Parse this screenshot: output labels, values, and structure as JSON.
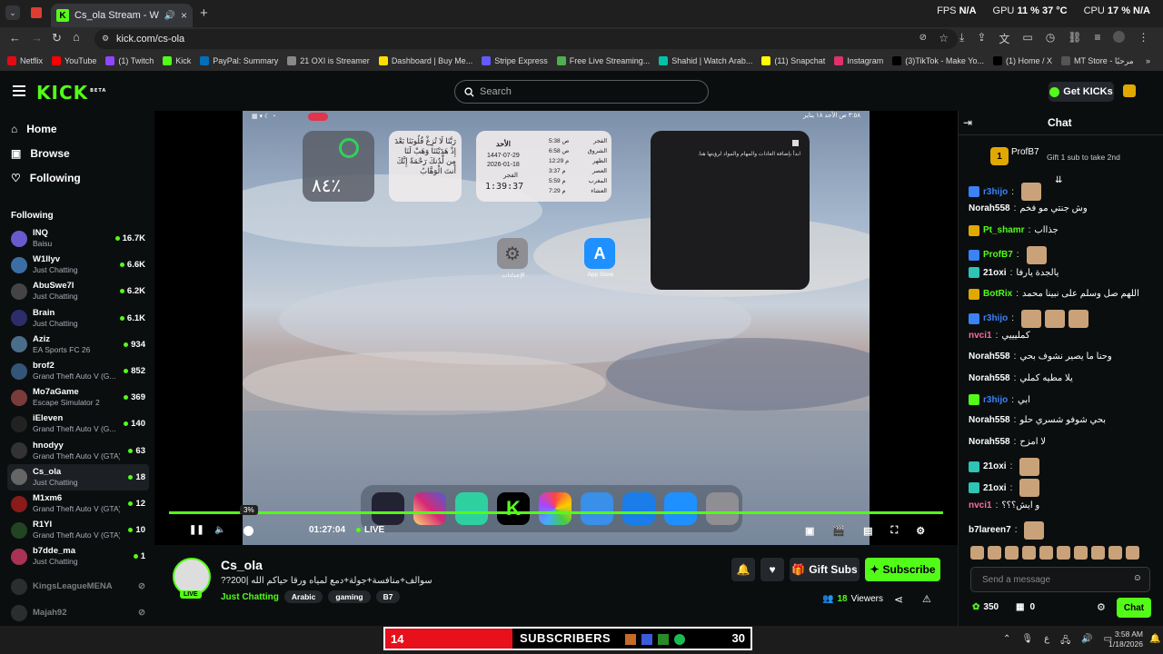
{
  "browser": {
    "tab_title": "Cs_ola Stream - Watch Live",
    "url": "kick.com/cs-ola",
    "stats": {
      "fps_label": "FPS",
      "fps": "N/A",
      "gpu_label": "GPU",
      "gpu": "11 %",
      "gpu_temp": "37 °C",
      "cpu_label": "CPU",
      "cpu": "17 %",
      "cpu_temp": "N/A"
    },
    "bookmarks": [
      {
        "label": "Netflix",
        "color": "#e50914"
      },
      {
        "label": "YouTube",
        "color": "#ff0000"
      },
      {
        "label": "(1) Twitch",
        "color": "#9146ff"
      },
      {
        "label": "Kick",
        "color": "#53fc18"
      },
      {
        "label": "PayPal: Summary",
        "color": "#0070ba"
      },
      {
        "label": "21 OXI is Streamer",
        "color": "#888888"
      },
      {
        "label": "Dashboard | Buy Me...",
        "color": "#ffdd00"
      },
      {
        "label": "Stripe Express",
        "color": "#635bff"
      },
      {
        "label": "Free Live Streaming...",
        "color": "#4caf50"
      },
      {
        "label": "Shahid | Watch Arab...",
        "color": "#00c2a8"
      },
      {
        "label": "(11) Snapchat",
        "color": "#fffc00"
      },
      {
        "label": "Instagram",
        "color": "#e1306c"
      },
      {
        "label": "(3)TikTok - Make Yo...",
        "color": "#000000"
      },
      {
        "label": "(1) Home / X",
        "color": "#000000"
      },
      {
        "label": "MT Store - مرحبًا",
        "color": "#555555"
      }
    ]
  },
  "header": {
    "logo": "KICK",
    "beta": "BETA",
    "search_placeholder": "Search",
    "get_kicks": "Get KICKs"
  },
  "sidebar": {
    "nav": [
      {
        "label": "Home"
      },
      {
        "label": "Browse"
      },
      {
        "label": "Following"
      }
    ],
    "following_heading": "Following",
    "channels": [
      {
        "name": "INQ",
        "game": "Baisu",
        "viewers": "16.7K",
        "color": "#6a5acd"
      },
      {
        "name": "W1llyv",
        "game": "Just Chatting",
        "viewers": "6.6K",
        "color": "#3b6ea5"
      },
      {
        "name": "AbuSwe7l",
        "game": "Just Chatting",
        "viewers": "6.2K",
        "color": "#444444"
      },
      {
        "name": "Brain",
        "game": "Just Chatting",
        "viewers": "6.1K",
        "color": "#2d2d6b"
      },
      {
        "name": "Aziz",
        "game": "EA Sports FC 26",
        "viewers": "934",
        "color": "#4a6d8c"
      },
      {
        "name": "brof2",
        "game": "Grand Theft Auto V (G...",
        "viewers": "852",
        "color": "#335577"
      },
      {
        "name": "Mo7aGame",
        "game": "Escape Simulator 2",
        "viewers": "369",
        "color": "#7a3b3b"
      },
      {
        "name": "iEleven",
        "game": "Grand Theft Auto V (G...",
        "viewers": "140",
        "color": "#222222"
      },
      {
        "name": "hnodyy",
        "game": "Grand Theft Auto V (GTA)",
        "viewers": "63",
        "color": "#333333"
      },
      {
        "name": "Cs_ola",
        "game": "Just Chatting",
        "viewers": "18",
        "color": "#666666"
      },
      {
        "name": "M1xm6",
        "game": "Grand Theft Auto V (GTA)",
        "viewers": "12",
        "color": "#8b1a1a"
      },
      {
        "name": "R1YI",
        "game": "Grand Theft Auto V (GTA)",
        "viewers": "10",
        "color": "#224422"
      },
      {
        "name": "b7dde_ma",
        "game": "Just Chatting",
        "viewers": "1",
        "color": "#aa3355"
      }
    ],
    "offline": [
      {
        "name": "KingsLeagueMENA"
      },
      {
        "name": "Majah92"
      }
    ]
  },
  "video": {
    "widgets": {
      "battery": "٨٤٪",
      "prayer_day": "الأحد",
      "hijri": "1447-07-29",
      "gregorian": "2026-01-18",
      "next_prayer": "الفجر",
      "countdown": "1:39:37",
      "prayers": [
        {
          "name": "الفجر",
          "time": "5:38 ص"
        },
        {
          "name": "الشروق",
          "time": "6:58 ص"
        },
        {
          "name": "الظهر",
          "time": "12:29 م"
        },
        {
          "name": "العصر",
          "time": "3:37 م"
        },
        {
          "name": "المغرب",
          "time": "5:59 م"
        },
        {
          "name": "العشاء",
          "time": "7:29 م"
        }
      ],
      "dua": "رَبَّنَا لَا تُزِغْ قُلُوبَنَا بَعْدَ إِذْ هَدَيْتَنَا وَهَبْ لَنَا مِن لَّدُنكَ رَحْمَةً إِنَّكَ أَنتَ الْوَهَّابُ",
      "notes": "ابدأ بإضافة العادات والمهام والمواد لرؤيتها هنا.",
      "settings_label": "الإعدادات",
      "appstore_label": "App Store",
      "ipad_status_right": "٣:٥٨ ص  الأحد ١٨ يناير"
    },
    "volume_tooltip": "3%",
    "elapsed": "01:27:04",
    "live": "LIVE",
    "progress": 1.0
  },
  "stream": {
    "channel": "Cs_ola",
    "live_badge": "LIVE",
    "title": "??سوالف+منافسة+جولة+دمع لمياه ورقا حياكم الله |200",
    "category": "Just Chatting",
    "tags": [
      "Arabic",
      "gaming",
      "B7"
    ],
    "viewers": "18",
    "viewers_label": "Viewers",
    "gift_subs": "Gift Subs",
    "subscribe": "Subscribe"
  },
  "chat": {
    "title": "Chat",
    "pinned_user": "ProfB7",
    "pinned_count": "1",
    "pinned_text": "Gift 1 sub to take 2nd",
    "messages": [
      {
        "user": "r3hijo",
        "color": "#3b82f6",
        "text": "",
        "emotes": 1
      },
      {
        "user": "Norah558",
        "color": "#ffffff",
        "text": "وش جنتي مو فخم",
        "emotes": 0
      },
      {
        "user": "Pt_shamr",
        "color": "#53fc18",
        "text": "جذااب",
        "emotes": 0
      },
      {
        "user": "ProfB7",
        "color": "#53fc18",
        "text": "",
        "emotes": 1
      },
      {
        "user": "21oxi",
        "color": "#ffffff",
        "text": "يالجدة يارفا",
        "emotes": 0
      },
      {
        "user": "BotRix",
        "color": "#53fc18",
        "text": "اللهم صل وسلم على نبينا محمد",
        "emotes": 0
      },
      {
        "user": "r3hijo",
        "color": "#3b82f6",
        "text": "",
        "emotes": 3
      },
      {
        "user": "nvci1",
        "color": "#ff6b9a",
        "text": "كمليييي",
        "emotes": 0
      },
      {
        "user": "Norah558",
        "color": "#ffffff",
        "text": "وحنا ما يصير نشوف بحي",
        "emotes": 0
      },
      {
        "user": "Norah558",
        "color": "#ffffff",
        "text": "يلا مطيه كملي",
        "emotes": 0
      },
      {
        "user": "r3hijo",
        "color": "#3b82f6",
        "text": "ابي",
        "emotes": 0
      },
      {
        "user": "Norah558",
        "color": "#ffffff",
        "text": "بحي شوفو شسري حلو",
        "emotes": 0
      },
      {
        "user": "Norah558",
        "color": "#ffffff",
        "text": "لا امزح",
        "emotes": 0
      },
      {
        "user": "21oxi",
        "color": "#ffffff",
        "text": "",
        "emotes": 1
      },
      {
        "user": "21oxi",
        "color": "#ffffff",
        "text": "",
        "emotes": 1
      },
      {
        "user": "nvci1",
        "color": "#ff6b9a",
        "text": "و ايش؟؟؟",
        "emotes": 0
      },
      {
        "user": "b7lareen7",
        "color": "#ffffff",
        "text": "",
        "emotes": 1
      }
    ],
    "send_placeholder": "Send a message",
    "points": "350",
    "gifts": "0",
    "chat_button": "Chat"
  },
  "taskbar": {
    "sub_count": "14",
    "sub_label": "SUBSCRIBERS",
    "sub_goal": "30",
    "lang": "ع",
    "time": "3:58 AM",
    "date": "1/18/2026"
  }
}
